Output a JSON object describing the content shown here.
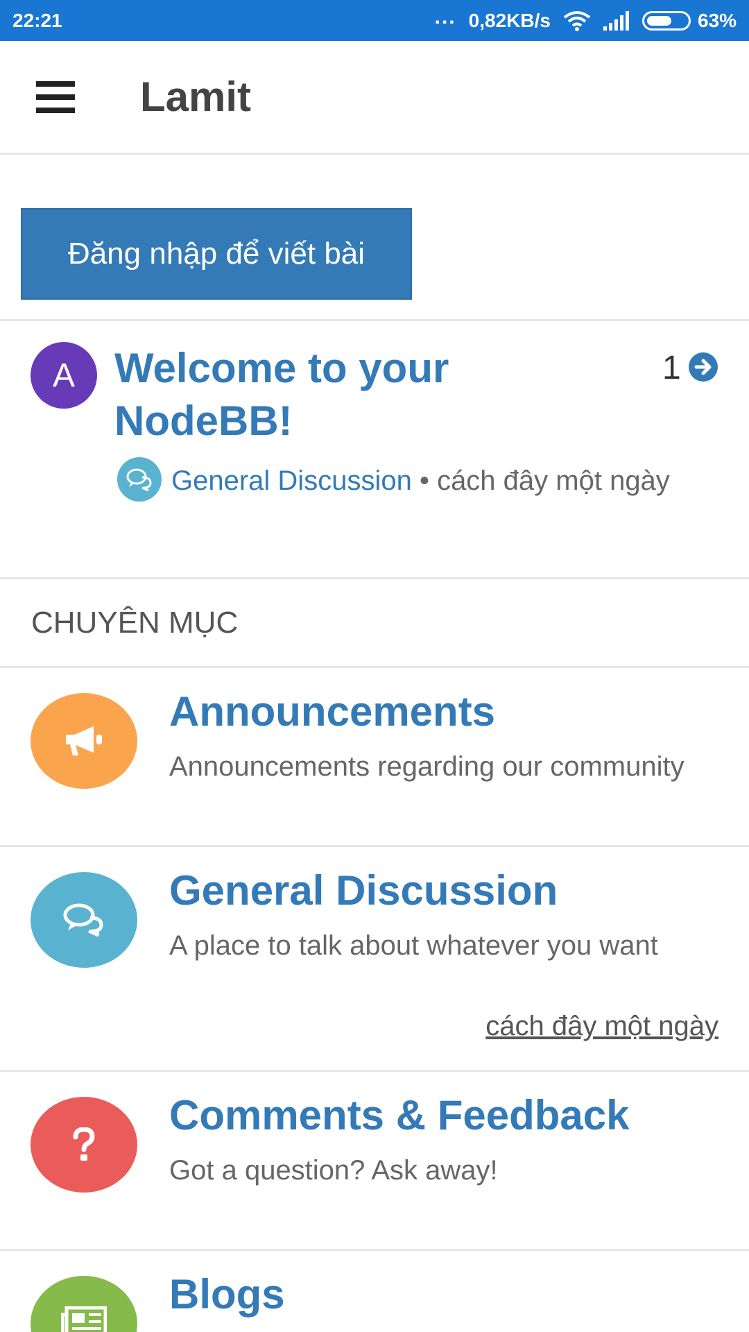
{
  "status_bar": {
    "time": "22:21",
    "dots": "...",
    "network_speed": "0,82KB/s",
    "battery_percent": "63%",
    "battery_level": 0.63,
    "icons": [
      "wifi-icon",
      "signal-icon",
      "battery-icon"
    ]
  },
  "app_bar": {
    "title": "Lamit",
    "menu_icon": "hamburger-menu-icon"
  },
  "login": {
    "label": "Đăng nhập để viết bài",
    "color": "#337ab7"
  },
  "topic": {
    "avatar_letter": "A",
    "avatar_color": "#673ab7",
    "title": "Welcome to your NodeBB!",
    "post_count": "1",
    "category": "General Discussion",
    "separator": " • ",
    "time": "cách đây một ngày"
  },
  "section": {
    "header": "CHUYÊN MỤC"
  },
  "categories": [
    {
      "name": "Announcements",
      "description": "Announcements regarding our community",
      "icon": "megaphone-icon",
      "color": "#fba44e",
      "last_activity": ""
    },
    {
      "name": "General Discussion",
      "description": "A place to talk about whatever you want",
      "icon": "chat-bubbles-icon",
      "color": "#59b3d0",
      "last_activity": "cách đây một ngày"
    },
    {
      "name": "Comments & Feedback",
      "description": "Got a question? Ask away!",
      "icon": "question-icon",
      "color": "#e95c5a",
      "last_activity": ""
    },
    {
      "name": "Blogs",
      "description": "",
      "icon": "newspaper-icon",
      "color": "#86ba4b",
      "last_activity": ""
    }
  ]
}
